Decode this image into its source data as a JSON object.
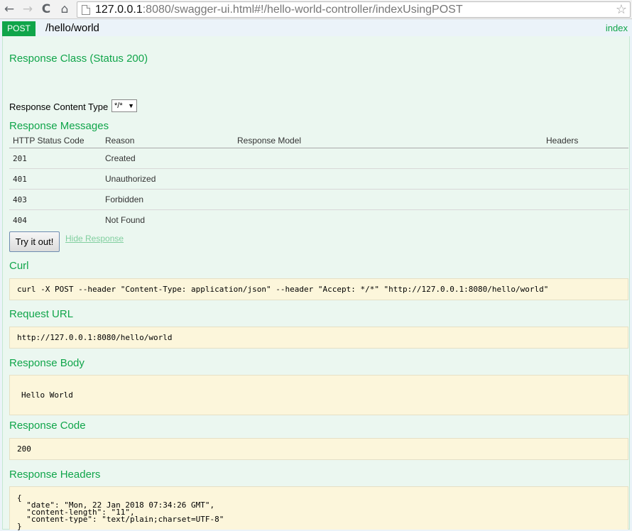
{
  "browser": {
    "back_icon": "←",
    "forward_icon": "→",
    "reload_icon": "C",
    "home_icon": "⌂",
    "star_icon": "☆",
    "url_host": "127.0.0.1",
    "url_rest": ":8080/swagger-ui.html#!/hello-world-controller/indexUsingPOST"
  },
  "operation": {
    "method": "POST",
    "path": "/hello/world",
    "index_link": "index",
    "response_class_title": "Response Class (Status 200)",
    "response_content_type_label": "Response Content Type",
    "response_content_type_value": "*/*",
    "response_messages_title": "Response Messages",
    "table_headers": [
      "HTTP Status Code",
      "Reason",
      "Response Model",
      "Headers"
    ],
    "table_rows": [
      {
        "code": "201",
        "reason": "Created"
      },
      {
        "code": "401",
        "reason": "Unauthorized"
      },
      {
        "code": "403",
        "reason": "Forbidden"
      },
      {
        "code": "404",
        "reason": "Not Found"
      }
    ],
    "try_button": "Try it out!",
    "hide_response": "Hide Response",
    "curl_title": "Curl",
    "curl_value": "curl -X POST --header \"Content-Type: application/json\" --header \"Accept: */*\" \"http://127.0.0.1:8080/hello/world\"",
    "request_url_title": "Request URL",
    "request_url_value": "http://127.0.0.1:8080/hello/world",
    "response_body_title": "Response Body",
    "response_body_value": "Hello World",
    "response_code_title": "Response Code",
    "response_code_value": "200",
    "response_headers_title": "Response Headers",
    "response_headers_value": "{\n  \"date\": \"Mon, 22 Jan 2018 07:34:26 GMT\",\n  \"content-length\": \"11\",\n  \"content-type\": \"text/plain;charset=UTF-8\"\n}"
  },
  "colors": {
    "accent_green": "#10a54a",
    "panel_bg": "#ebf7f0",
    "code_block_bg": "#fcf6db"
  }
}
